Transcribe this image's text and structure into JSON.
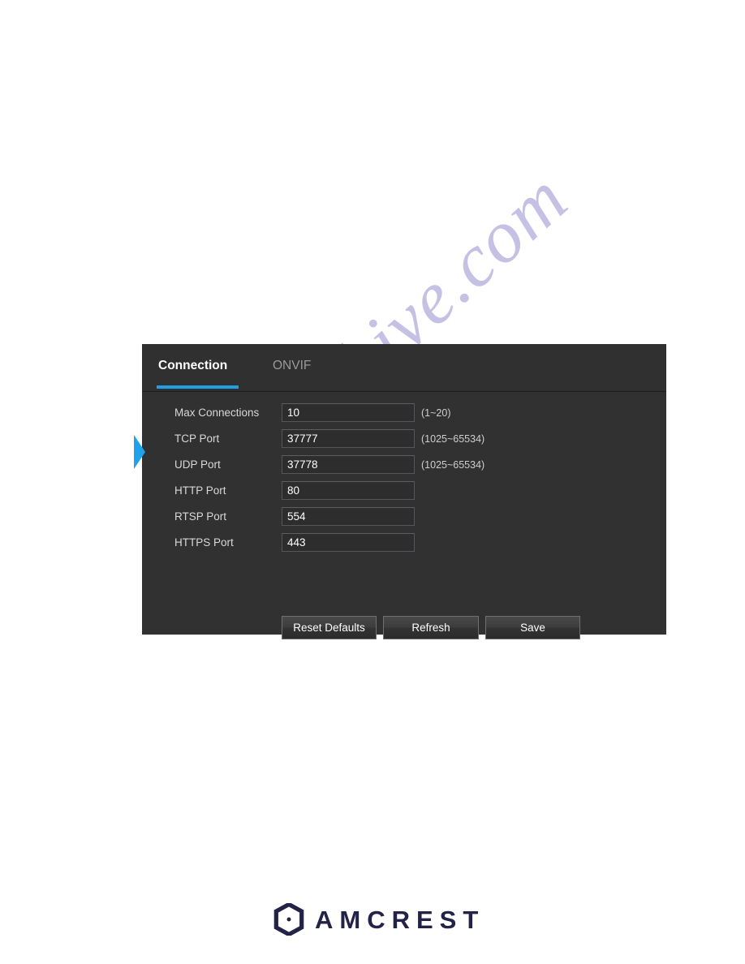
{
  "panel": {
    "tabs": [
      {
        "label": "Connection",
        "active": true
      },
      {
        "label": "ONVIF",
        "active": false
      }
    ],
    "fields": [
      {
        "label": "Max Connections",
        "value": "10",
        "hint": "(1~20)"
      },
      {
        "label": "TCP Port",
        "value": "37777",
        "hint": "(1025~65534)"
      },
      {
        "label": "UDP Port",
        "value": "37778",
        "hint": "(1025~65534)"
      },
      {
        "label": "HTTP Port",
        "value": "80",
        "hint": ""
      },
      {
        "label": "RTSP Port",
        "value": "554",
        "hint": ""
      },
      {
        "label": "HTTPS Port",
        "value": "443",
        "hint": ""
      }
    ],
    "buttons": {
      "reset_defaults": "Reset Defaults",
      "refresh": "Refresh",
      "save": "Save"
    },
    "accent_color": "#1f9fe8",
    "background_color": "#303030"
  },
  "watermark": {
    "text": "manualshive.com"
  },
  "footer": {
    "brand": "AMCREST",
    "brand_color": "#232347"
  }
}
